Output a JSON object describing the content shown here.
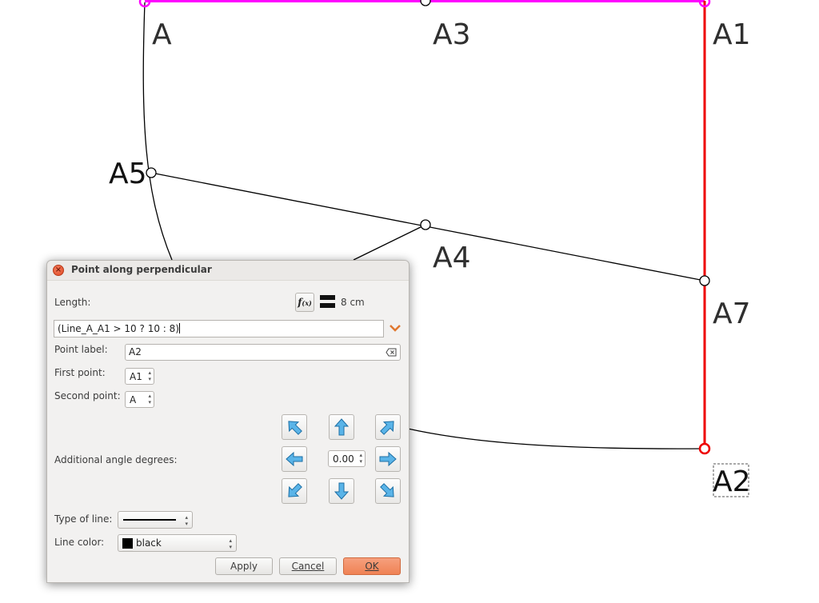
{
  "canvas": {
    "point_labels": [
      "A",
      "A3",
      "A1",
      "A5",
      "A4",
      "A7",
      "A2"
    ],
    "colors": {
      "highlight_line": "#ff00ff",
      "selected_line": "#ee0000",
      "geometry": "#000000"
    }
  },
  "dialog": {
    "title": "Point along perpendicular",
    "close_icon": "close-icon",
    "length_label": "Length:",
    "fx_button_label": "f(x)",
    "length_value": "8 cm",
    "formula": "(Line_A_A1 > 10 ? 10 : 8)",
    "point_label_label": "Point label:",
    "point_label_value": "A2",
    "first_point_label": "First point:",
    "first_point_value": "A1",
    "second_point_label": "Second point:",
    "second_point_value": "A",
    "angle_label": "Additional angle degrees:",
    "angle_value": "0.00",
    "type_of_line_label": "Type of line:",
    "line_color_label": "Line color:",
    "line_color_value": "black",
    "apply_label": "Apply",
    "cancel_label": "Cancel",
    "ok_label": "OK"
  }
}
